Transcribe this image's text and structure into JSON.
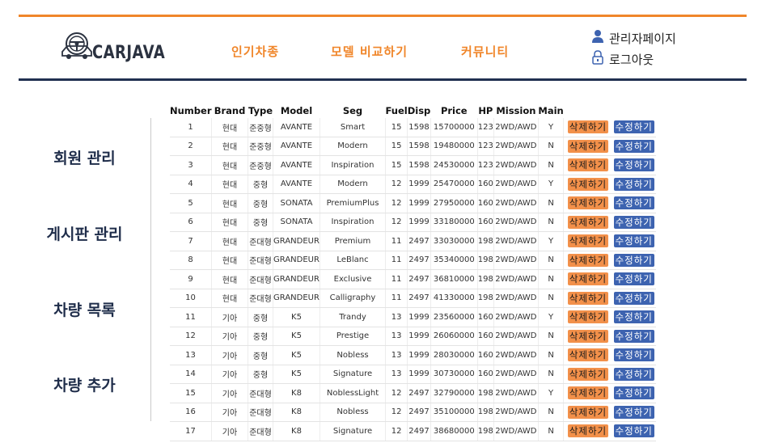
{
  "logo": {
    "text": "CARJAVA"
  },
  "nav": [
    "인기차종",
    "모델 비교하기",
    "커뮤니티"
  ],
  "user": {
    "admin_label": "관리자페이지",
    "logout_label": "로그아웃"
  },
  "sidebar": [
    "회원 관리",
    "게시판 관리",
    "차량 목록",
    "차량 추가"
  ],
  "colors": {
    "accent": "#f0862a",
    "navy": "#203050",
    "delete_btn": "#f2904a",
    "edit_btn": "#3d63b0"
  },
  "table": {
    "headers": [
      "Number",
      "Brand",
      "Type",
      "Model",
      "Seg",
      "Fuel",
      "Disp",
      "Price",
      "HP",
      "Mission",
      "Main"
    ],
    "delete_label": "삭제하기",
    "edit_label": "수정하기",
    "rows": [
      [
        "1",
        "현대",
        "준중형",
        "AVANTE",
        "Smart",
        "15",
        "1598",
        "15700000",
        "123",
        "2WD/AWD",
        "Y"
      ],
      [
        "2",
        "현대",
        "준중형",
        "AVANTE",
        "Modern",
        "15",
        "1598",
        "19480000",
        "123",
        "2WD/AWD",
        "N"
      ],
      [
        "3",
        "현대",
        "준중형",
        "AVANTE",
        "Inspiration",
        "15",
        "1598",
        "24530000",
        "123",
        "2WD/AWD",
        "N"
      ],
      [
        "4",
        "현대",
        "중형",
        "AVANTE",
        "Modern",
        "12",
        "1999",
        "25470000",
        "160",
        "2WD/AWD",
        "Y"
      ],
      [
        "5",
        "현대",
        "중형",
        "SONATA",
        "PremiumPlus",
        "12",
        "1999",
        "27950000",
        "160",
        "2WD/AWD",
        "N"
      ],
      [
        "6",
        "현대",
        "중형",
        "SONATA",
        "Inspiration",
        "12",
        "1999",
        "33180000",
        "160",
        "2WD/AWD",
        "N"
      ],
      [
        "7",
        "현대",
        "준대형",
        "GRANDEUR",
        "Premium",
        "11",
        "2497",
        "33030000",
        "198",
        "2WD/AWD",
        "Y"
      ],
      [
        "8",
        "현대",
        "준대형",
        "GRANDEUR",
        "LeBlanc",
        "11",
        "2497",
        "35340000",
        "198",
        "2WD/AWD",
        "N"
      ],
      [
        "9",
        "현대",
        "준대형",
        "GRANDEUR",
        "Exclusive",
        "11",
        "2497",
        "36810000",
        "198",
        "2WD/AWD",
        "N"
      ],
      [
        "10",
        "현대",
        "준대형",
        "GRANDEUR",
        "Calligraphy",
        "11",
        "2497",
        "41330000",
        "198",
        "2WD/AWD",
        "N"
      ],
      [
        "11",
        "기아",
        "중형",
        "K5",
        "Trandy",
        "13",
        "1999",
        "23560000",
        "160",
        "2WD/AWD",
        "Y"
      ],
      [
        "12",
        "기아",
        "중형",
        "K5",
        "Prestige",
        "13",
        "1999",
        "26060000",
        "160",
        "2WD/AWD",
        "N"
      ],
      [
        "13",
        "기아",
        "중형",
        "K5",
        "Nobless",
        "13",
        "1999",
        "28030000",
        "160",
        "2WD/AWD",
        "N"
      ],
      [
        "14",
        "기아",
        "중형",
        "K5",
        "Signature",
        "13",
        "1999",
        "30730000",
        "160",
        "2WD/AWD",
        "N"
      ],
      [
        "15",
        "기아",
        "준대형",
        "K8",
        "NoblessLight",
        "12",
        "2497",
        "32790000",
        "198",
        "2WD/AWD",
        "Y"
      ],
      [
        "16",
        "기아",
        "준대형",
        "K8",
        "Nobless",
        "12",
        "2497",
        "35100000",
        "198",
        "2WD/AWD",
        "N"
      ],
      [
        "17",
        "기아",
        "준대형",
        "K8",
        "Signature",
        "12",
        "2497",
        "38680000",
        "198",
        "2WD/AWD",
        "N"
      ]
    ]
  }
}
